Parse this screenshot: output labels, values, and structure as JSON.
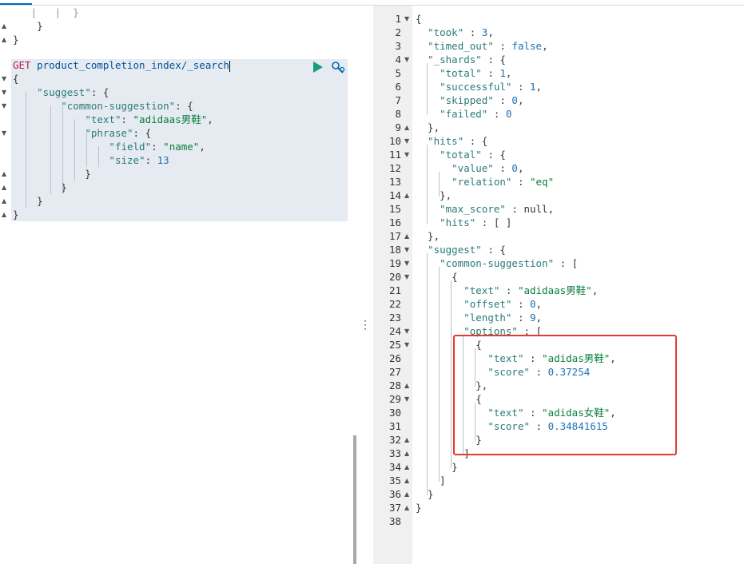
{
  "request": {
    "method": "GET",
    "url": "product_completion_index/_search",
    "pre_lines": [
      "    |   ",
      "}",
      "}"
    ],
    "body": {
      "open": "{",
      "suggest_key": "\"suggest\"",
      "common_key": "\"common-suggestion\"",
      "text_key": "\"text\"",
      "text_val": "\"adidaas男鞋\"",
      "phrase_key": "\"phrase\"",
      "field_key": "\"field\"",
      "field_val": "\"name\"",
      "size_key": "\"size\"",
      "size_val": "13",
      "close": "}"
    }
  },
  "response": {
    "line_numbers": [
      "1",
      "2",
      "3",
      "4",
      "5",
      "6",
      "7",
      "8",
      "9",
      "10",
      "11",
      "12",
      "13",
      "14",
      "15",
      "16",
      "17",
      "18",
      "19",
      "20",
      "21",
      "22",
      "23",
      "24",
      "25",
      "26",
      "27",
      "28",
      "29",
      "30",
      "31",
      "32",
      "33",
      "34",
      "35",
      "36",
      "37",
      "38"
    ],
    "took": "3",
    "timed_out": "false",
    "shards_total": "1",
    "shards_successful": "1",
    "shards_skipped": "0",
    "shards_failed": "0",
    "hits_total_value": "0",
    "hits_total_relation": "\"eq\"",
    "max_score": "null",
    "suggest_text": "\"adidaas男鞋\"",
    "offset": "0",
    "length": "9",
    "options": [
      {
        "text": "\"adidas男鞋\"",
        "score": "0.37254"
      },
      {
        "text": "\"adidas女鞋\"",
        "score": "0.34841615"
      }
    ]
  },
  "icons": {
    "play": "play-icon",
    "wrench": "wrench-icon",
    "splitter": "vertical-dots-icon"
  },
  "colors": {
    "highlight": "#e33b2e",
    "play": "#1a9c7f",
    "method": "#c0195a"
  }
}
